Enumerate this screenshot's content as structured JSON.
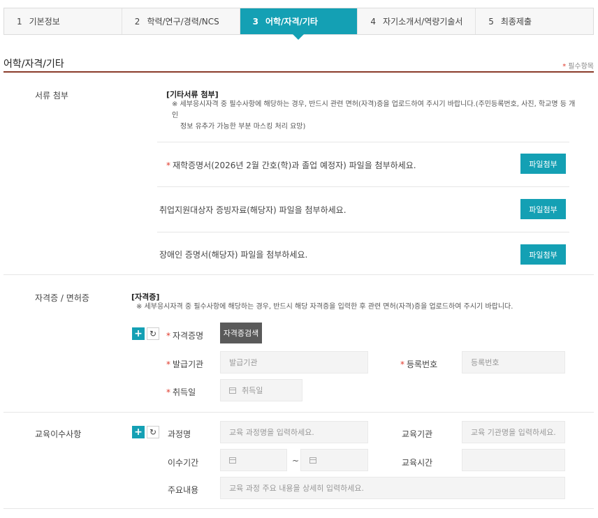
{
  "steps": [
    {
      "num": "1",
      "label": "기본정보"
    },
    {
      "num": "2",
      "label": "학력/연구/경력/NCS"
    },
    {
      "num": "3",
      "label": "어학/자격/기타"
    },
    {
      "num": "4",
      "label": "자기소개서/역량기술서"
    },
    {
      "num": "5",
      "label": "최종제출"
    }
  ],
  "section": {
    "title": "어학/자격/기타",
    "required_note": "필수항목",
    "star": "*"
  },
  "documents": {
    "label": "서류 첨부",
    "heading": "[기타서류 첨부]",
    "note_line1": "※ 세부응시자격 중 필수사항에 해당하는 경우, 반드시 관련 면허(자격)증을 업로드하여 주시기 바랍니다.(주민등록번호, 사진, 학교명 등 개인",
    "note_line2": "정보 유추가 가능한 부분 마스킹 처리 요망)",
    "items": [
      {
        "text": "재학증명서(2026년 2월 간호(학)과 졸업 예정자) 파일을 첨부하세요.",
        "button": "파일첨부"
      },
      {
        "text": "취업지원대상자 증빙자료(해당자) 파일을 첨부하세요.",
        "button": "파일첨부"
      },
      {
        "text": "장애인 증명서(해당자) 파일을 첨부하세요.",
        "button": "파일첨부"
      }
    ]
  },
  "license": {
    "label": "자격증 / 면허증",
    "heading": "[자격증]",
    "note": "※ 세부응시자격 중 필수사항에 해당하는 경우, 반드시 해당 자격증을 입력한 후 관련 면허(자격)증을 업로드하여 주시기 바랍니다.",
    "plus": "+",
    "reset": "↻",
    "name_label": "자격증명",
    "search_button": "자격증검색",
    "issuer_label": "발급기관",
    "issuer_placeholder": "발급기관",
    "reg_label": "등록번호",
    "reg_placeholder": "등록번호",
    "date_label": "취득일",
    "date_placeholder": "취득일"
  },
  "education": {
    "label": "교육이수사항",
    "plus": "+",
    "reset": "↻",
    "course_label": "과정명",
    "course_placeholder": "교육 과정명을 입력하세요.",
    "org_label": "교육기관",
    "org_placeholder": "교육 기관명을 입력하세요.",
    "period_label": "이수기간",
    "period_sep": "~",
    "hours_label": "교육시간",
    "content_label": "주요내용",
    "content_placeholder": "교육 과정 주요 내용을 상세히 입력하세요."
  }
}
